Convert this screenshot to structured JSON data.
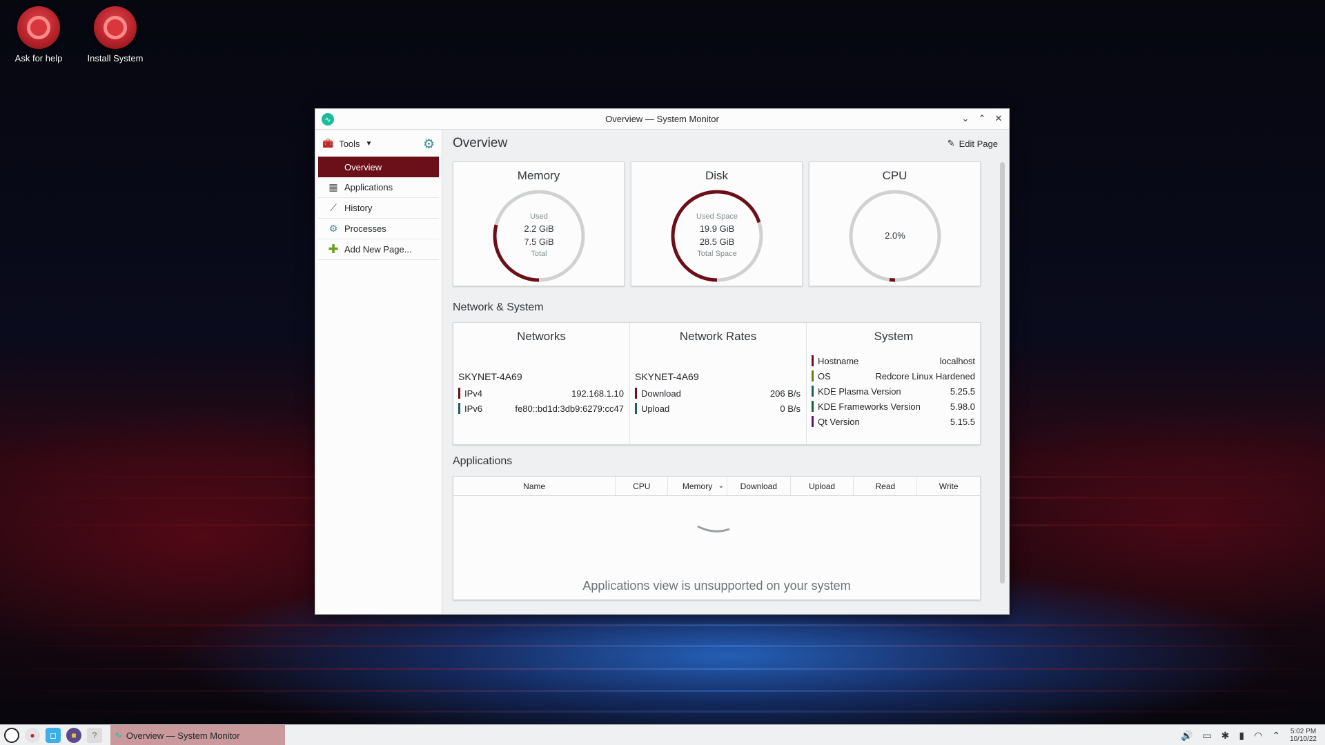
{
  "desktop": {
    "icons": [
      {
        "label": "Ask for help"
      },
      {
        "label": "Install System"
      }
    ]
  },
  "window": {
    "title": "Overview — System Monitor",
    "controls": {
      "minimize": "⌄",
      "maximize": "⌃",
      "close": "✕"
    }
  },
  "sidebar": {
    "tools_label": "Tools",
    "items": [
      {
        "label": "Overview",
        "icon": "overview-icon"
      },
      {
        "label": "Applications",
        "icon": "grid-icon"
      },
      {
        "label": "History",
        "icon": "chart-icon"
      },
      {
        "label": "Processes",
        "icon": "gear-icon"
      },
      {
        "label": "Add New Page...",
        "icon": "plus-icon"
      }
    ]
  },
  "main": {
    "page_title": "Overview",
    "edit_page_label": "Edit Page",
    "memory": {
      "title": "Memory",
      "top_label": "Used",
      "used": "2.2 GiB",
      "total": "7.5 GiB",
      "bottom_label": "Total",
      "fraction": 0.29
    },
    "disk": {
      "title": "Disk",
      "top_label": "Used Space",
      "used": "19.9 GiB",
      "total": "28.5 GiB",
      "bottom_label": "Total Space",
      "fraction": 0.7
    },
    "cpu": {
      "title": "CPU",
      "value": "2.0%",
      "fraction": 0.02
    },
    "network_section_label": "Network & System",
    "networks": {
      "title": "Networks",
      "hostname": "SKYNET-4A69",
      "rows": [
        {
          "label": "IPv4",
          "value": "192.168.1.10"
        },
        {
          "label": "IPv6",
          "value": "fe80::bd1d:3db9:6279:cc47"
        }
      ]
    },
    "network_rates": {
      "title": "Network Rates",
      "hostname": "SKYNET-4A69",
      "rows": [
        {
          "label": "Download",
          "value": "206 B/s"
        },
        {
          "label": "Upload",
          "value": "0 B/s"
        }
      ]
    },
    "system": {
      "title": "System",
      "rows": [
        {
          "label": "Hostname",
          "value": "localhost"
        },
        {
          "label": "OS",
          "value": "Redcore Linux Hardened"
        },
        {
          "label": "KDE Plasma Version",
          "value": "5.25.5"
        },
        {
          "label": "KDE Frameworks Version",
          "value": "5.98.0"
        },
        {
          "label": "Qt Version",
          "value": "5.15.5"
        }
      ]
    },
    "applications_section_label": "Applications",
    "app_table": {
      "columns": [
        "Name",
        "CPU",
        "Memory",
        "Download",
        "Upload",
        "Read",
        "Write"
      ],
      "sorted_column": "Memory",
      "message": "Applications view is unsupported on your system"
    }
  },
  "taskbar": {
    "task_label": "Overview — System Monitor",
    "time": "5:02 PM",
    "date": "10/10/22"
  },
  "colors": {
    "accent": "#6b0f18",
    "gauge_track": "#cfd1d3",
    "gauge_fill": "#6b0f18"
  }
}
